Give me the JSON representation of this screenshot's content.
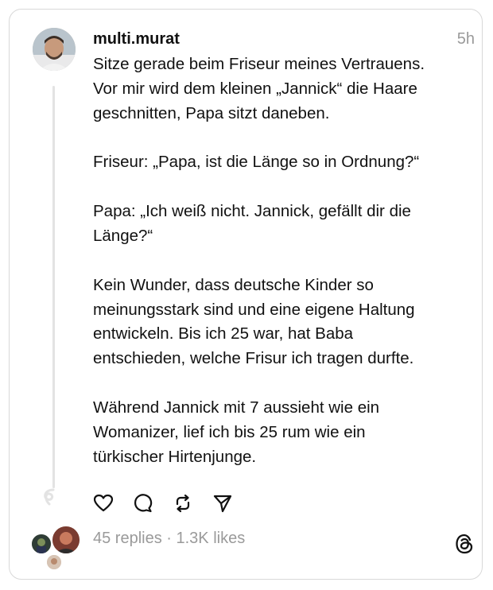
{
  "post": {
    "username": "multi.murat",
    "time": "5h",
    "paragraphs": [
      "Sitze gerade beim Friseur meines Vertrauens.\nVor mir wird dem kleinen „Jannick“ die Haare\ngeschnitten, Papa sitzt daneben.",
      "Friseur: „Papa, ist die Länge so in Ordnung?“",
      "Papa: „Ich weiß nicht. Jannick, gefällt dir die\nLänge?“",
      "Kein Wunder, dass deutsche Kinder so\nmeinungsstark sind und eine eigene Haltung\nentwickeln. Bis ich 25 war, hat Baba\nentschieden, welche Frisur ich tragen durfte.",
      "Während Jannick mit 7 aussieht wie ein\nWomanizer, lief ich bis 25 rum wie ein\ntürkischer Hirtenjunge."
    ]
  },
  "stats": {
    "text": "45 replies · 1.3K likes"
  },
  "icons": {
    "like": "heart-icon",
    "reply": "comment-icon",
    "repost": "repost-icon",
    "share": "send-icon",
    "brand": "threads-logo-icon"
  },
  "colors": {
    "text": "#111111",
    "muted": "#9a9a9a",
    "border": "#d8d8d8"
  }
}
